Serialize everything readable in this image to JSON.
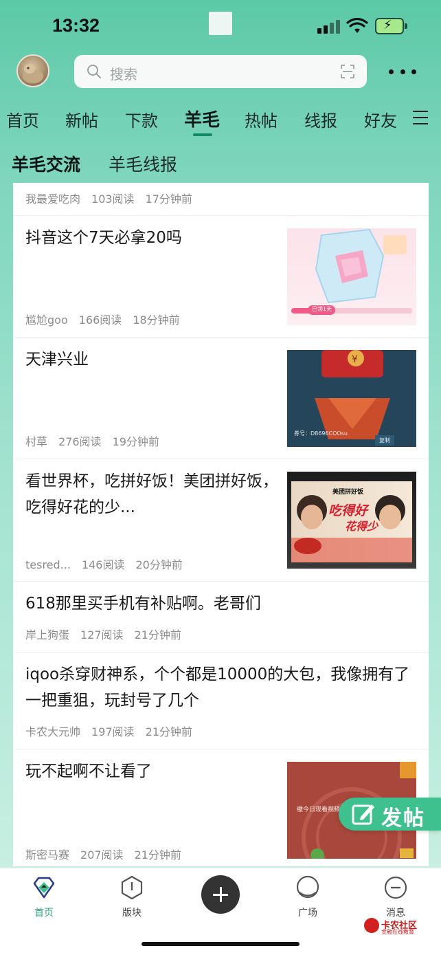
{
  "status_bar": {
    "time": "13:32"
  },
  "header": {
    "search_placeholder": "搜索"
  },
  "top_tabs": [
    {
      "label": "首页"
    },
    {
      "label": "新帖"
    },
    {
      "label": "下款"
    },
    {
      "label": "羊毛",
      "active": true
    },
    {
      "label": "热帖"
    },
    {
      "label": "线报"
    },
    {
      "label": "好友"
    }
  ],
  "sub_tabs": [
    {
      "label": "羊毛交流",
      "active": true
    },
    {
      "label": "羊毛线报"
    }
  ],
  "feed": [
    {
      "title": "",
      "author": "我最爱吃肉",
      "reads": "103阅读",
      "time": "17分钟前"
    },
    {
      "title": "抖音这个7天必拿20吗",
      "author": "尴尬goo",
      "reads": "166阅读",
      "time": "18分钟前",
      "thumb": {
        "caption": "已领1天"
      }
    },
    {
      "title": "天津兴业",
      "author": "村草",
      "reads": "276阅读",
      "time": "19分钟前",
      "thumb": {
        "code_label": "券号：D8696COOsu",
        "copy_label": "复制"
      }
    },
    {
      "title": "看世界杯，吃拼好饭！美团拼好饭，吃得好花的少...",
      "author": "tesred...",
      "reads": "146阅读",
      "time": "20分钟前",
      "thumb": {
        "brand": "美团拼好饭",
        "slogan1": "吃得好",
        "slogan2": "花得少"
      }
    },
    {
      "title": "618那里买手机有补贴啊。老哥们",
      "author": "岸上狗蛋",
      "reads": "127阅读",
      "time": "21分钟前"
    },
    {
      "title": "iqoo杀穿财神系，个个都是10000的大包，我像拥有了一把重狙，玩封号了几个",
      "author": "卡农大元帅",
      "reads": "197阅读",
      "time": "21分钟前"
    },
    {
      "title": "玩不起啊不让看了",
      "author": "斯密马赛",
      "reads": "207阅读",
      "time": "21分钟前",
      "thumb": {
        "caption": "缴今日观看视频"
      }
    }
  ],
  "post_fab": {
    "label": "发帖"
  },
  "bottom_nav": [
    {
      "label": "首页",
      "icon": "home-diamond-icon",
      "active": true
    },
    {
      "label": "版块",
      "icon": "section-icon"
    },
    {
      "label": "",
      "icon": "plus-icon"
    },
    {
      "label": "广场",
      "icon": "plaza-icon"
    },
    {
      "label": "消息",
      "icon": "message-icon"
    }
  ],
  "watermark": {
    "title": "卡农社区",
    "subtitle": "金融在线教育"
  },
  "colors": {
    "accent": "#2ca87b",
    "header_bg": "#5cc9a6",
    "fab": "#3ec08f"
  }
}
